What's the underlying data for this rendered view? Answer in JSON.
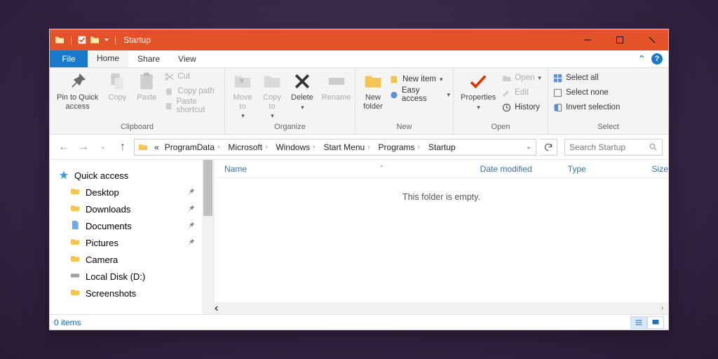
{
  "title": "Startup",
  "tabs": {
    "file": "File",
    "home": "Home",
    "share": "Share",
    "view": "View"
  },
  "ribbon": {
    "clipboard": {
      "label": "Clipboard",
      "pin": "Pin to Quick\naccess",
      "copy": "Copy",
      "paste": "Paste",
      "cut": "Cut",
      "copypath": "Copy path",
      "pasteshortcut": "Paste shortcut"
    },
    "organize": {
      "label": "Organize",
      "moveto": "Move\nto",
      "copyto": "Copy\nto",
      "delete": "Delete",
      "rename": "Rename"
    },
    "new": {
      "label": "New",
      "newfolder": "New\nfolder",
      "newitem": "New item",
      "easyaccess": "Easy access"
    },
    "open": {
      "label": "Open",
      "properties": "Properties",
      "open": "Open",
      "edit": "Edit",
      "history": "History"
    },
    "select": {
      "label": "Select",
      "selectall": "Select all",
      "selectnone": "Select none",
      "invert": "Invert selection"
    }
  },
  "breadcrumbs": [
    "ProgramData",
    "Microsoft",
    "Windows",
    "Start Menu",
    "Programs",
    "Startup"
  ],
  "breadcrumb_prefix": "«",
  "search_placeholder": "Search Startup",
  "nav": {
    "quickaccess": "Quick access",
    "items": [
      {
        "label": "Desktop",
        "pin": true,
        "ic": "folder"
      },
      {
        "label": "Downloads",
        "pin": true,
        "ic": "folder"
      },
      {
        "label": "Documents",
        "pin": true,
        "ic": "doc"
      },
      {
        "label": "Pictures",
        "pin": true,
        "ic": "folder"
      },
      {
        "label": "Camera",
        "pin": false,
        "ic": "folder"
      },
      {
        "label": "Local Disk (D:)",
        "pin": false,
        "ic": "disk"
      },
      {
        "label": "Screenshots",
        "pin": false,
        "ic": "folder"
      }
    ]
  },
  "columns": {
    "name": "Name",
    "date": "Date modified",
    "type": "Type",
    "size": "Size"
  },
  "empty_msg": "This folder is empty.",
  "status": "0 items"
}
